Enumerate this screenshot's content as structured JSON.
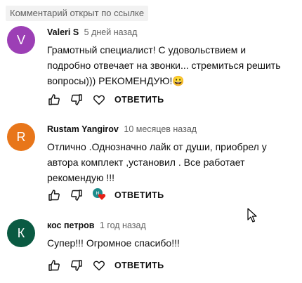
{
  "banner": "Комментарий открыт по ссылке",
  "reply_label": "ОТВЕТИТЬ",
  "comments": [
    {
      "avatar_letter": "V",
      "avatar_color": "#9c3fb5",
      "author": "Valeri S",
      "time": "5 дней назад",
      "text": "Грамотный специалист! С удовольствием и подробно отвечает на звонки... стремиться решить вопросы))) РЕКОМЕНДУЮ!😀"
    },
    {
      "avatar_letter": "R",
      "avatar_color": "#e8761a",
      "author": "Rustam Yangirov",
      "time": "10 месяцев назад",
      "text": "Отлично .Однозначно лайк от души, приобрел  у автора комплект  ,установил . Все работает рекомендую !!!",
      "creator_heart_letter": "н"
    },
    {
      "avatar_letter": "К",
      "avatar_color": "#0a5a42",
      "author": "кос петров",
      "time": "1 год назад",
      "text": "Супер!!! Огромное спасибо!!!"
    }
  ]
}
